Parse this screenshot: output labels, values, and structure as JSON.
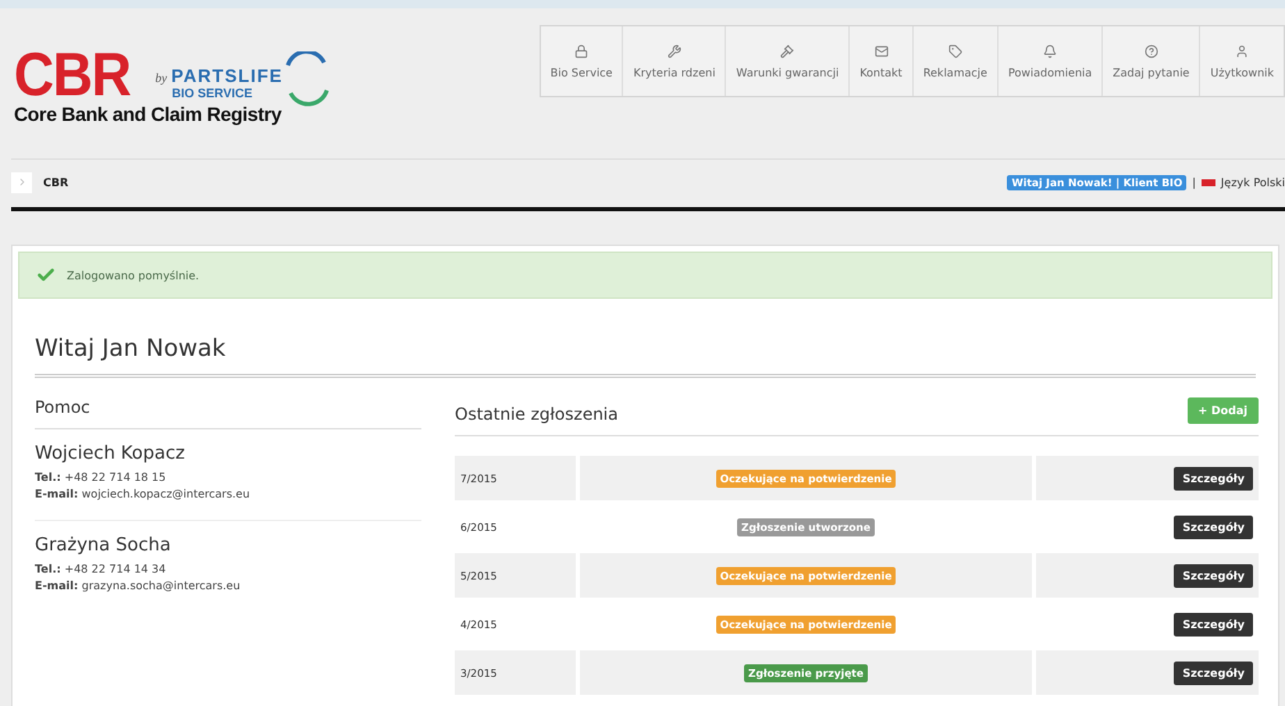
{
  "logo": {
    "title": "CBR",
    "by": "by",
    "brand": "PARTSLIFE",
    "sub_brand": "BIO SERVICE",
    "subtitle": "Core Bank and Claim Registry"
  },
  "nav": [
    {
      "label": "Bio Service"
    },
    {
      "label": "Kryteria rdzeni"
    },
    {
      "label": "Warunki gwarancji"
    },
    {
      "label": "Kontakt"
    },
    {
      "label": "Reklamacje"
    },
    {
      "label": "Powiadomienia"
    },
    {
      "label": "Zadaj pytanie"
    },
    {
      "label": "Użytkownik"
    }
  ],
  "breadcrumb": "CBR",
  "user_badge": "Witaj Jan Nowak! | Klient BIO",
  "separator": "|",
  "language": "Język Polski",
  "alert": "Zalogowano pomyślnie.",
  "heading": "Witaj Jan Nowak",
  "help": {
    "title": "Pomoc",
    "contacts": [
      {
        "name": "Wojciech Kopacz",
        "phone_label": "Tel.:",
        "phone": "+48 22 714 18 15",
        "email_label": "E-mail:",
        "email": "wojciech.kopacz@intercars.eu"
      },
      {
        "name": "Grażyna Socha",
        "phone_label": "Tel.:",
        "phone": "+48 22 714 14 34",
        "email_label": "E-mail:",
        "email": "grazyna.socha@intercars.eu"
      }
    ]
  },
  "claims": {
    "title": "Ostatnie zgłoszenia",
    "add_button": "+ Dodaj",
    "rows": [
      {
        "number": "7/2015",
        "status": "Oczekujące na potwierdzenie",
        "color": "#f0a030",
        "action": "Szczegóły"
      },
      {
        "number": "6/2015",
        "status": "Zgłoszenie utworzone",
        "color": "#999999",
        "action": "Szczegóły"
      },
      {
        "number": "5/2015",
        "status": "Oczekujące na potwierdzenie",
        "color": "#f0a030",
        "action": "Szczegóły"
      },
      {
        "number": "4/2015",
        "status": "Oczekujące na potwierdzenie",
        "color": "#f0a030",
        "action": "Szczegóły"
      },
      {
        "number": "3/2015",
        "status": "Zgłoszenie przyjęte",
        "color": "#4a9a4a",
        "action": "Szczegóły"
      }
    ]
  }
}
